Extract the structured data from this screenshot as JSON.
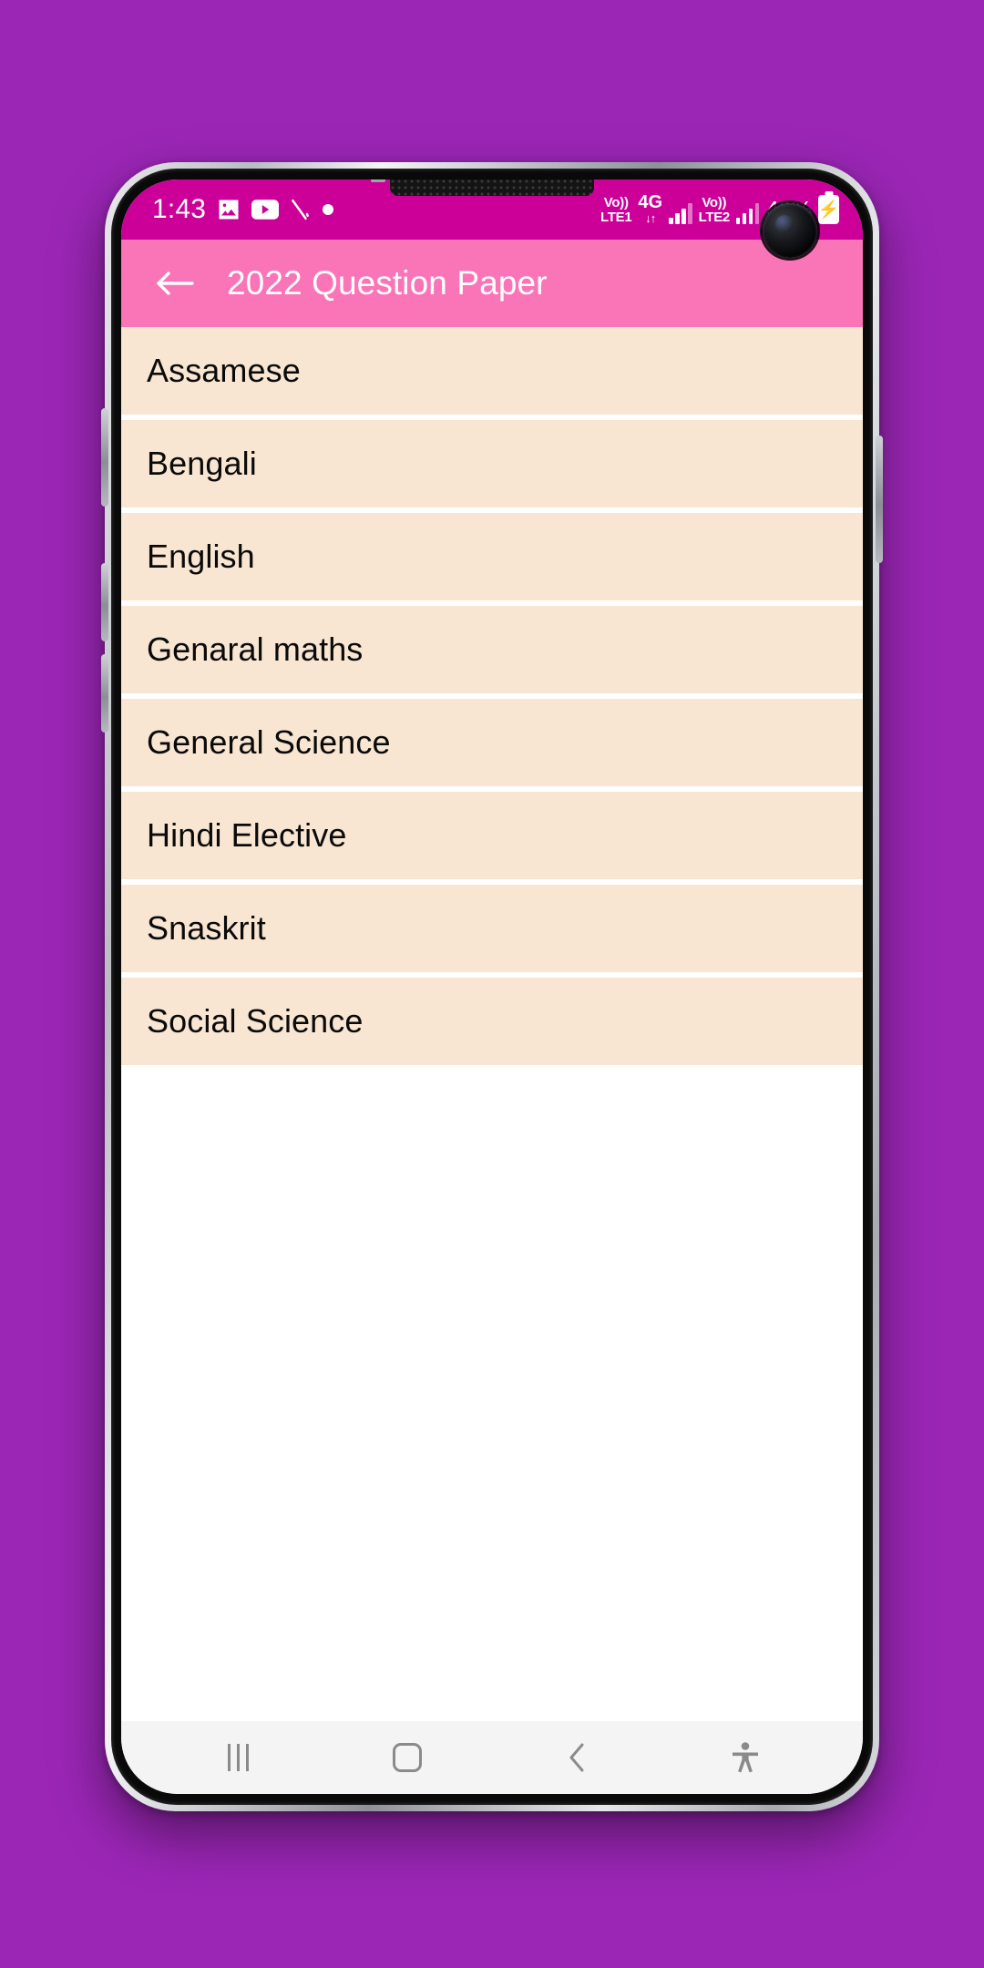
{
  "page": {
    "background_color": "#9B26B6",
    "device": "android-phone-mockup"
  },
  "status_bar": {
    "background_color": "#CC0099",
    "time": "1:43",
    "left_icons": [
      "gallery-icon",
      "youtube-icon",
      "no-sound-icon",
      "dot-icon"
    ],
    "volte1_top": "Vo))",
    "volte1_bottom": "LTE1",
    "network_label": "4G",
    "network_arrows": "↓↑",
    "volte2_top": "Vo))",
    "volte2_bottom": "LTE2",
    "battery_percent": "42%",
    "battery_state": "charging"
  },
  "app_bar": {
    "background_color": "#FA74B8",
    "back_icon": "arrow-left-icon",
    "title": "2022 Question Paper"
  },
  "list": {
    "item_background_color": "#F9E6D2",
    "items": [
      {
        "label": "Assamese"
      },
      {
        "label": "Bengali"
      },
      {
        "label": "English"
      },
      {
        "label": "Genaral maths"
      },
      {
        "label": "General Science"
      },
      {
        "label": "Hindi Elective"
      },
      {
        "label": "Snaskrit"
      },
      {
        "label": "Social Science"
      }
    ]
  },
  "nav_bar": {
    "background_color": "#F4F4F4",
    "buttons": [
      {
        "name": "recents",
        "icon": "recents-icon"
      },
      {
        "name": "home",
        "icon": "home-icon"
      },
      {
        "name": "back",
        "icon": "chevron-left-icon"
      },
      {
        "name": "accessibility",
        "icon": "accessibility-icon"
      }
    ]
  }
}
